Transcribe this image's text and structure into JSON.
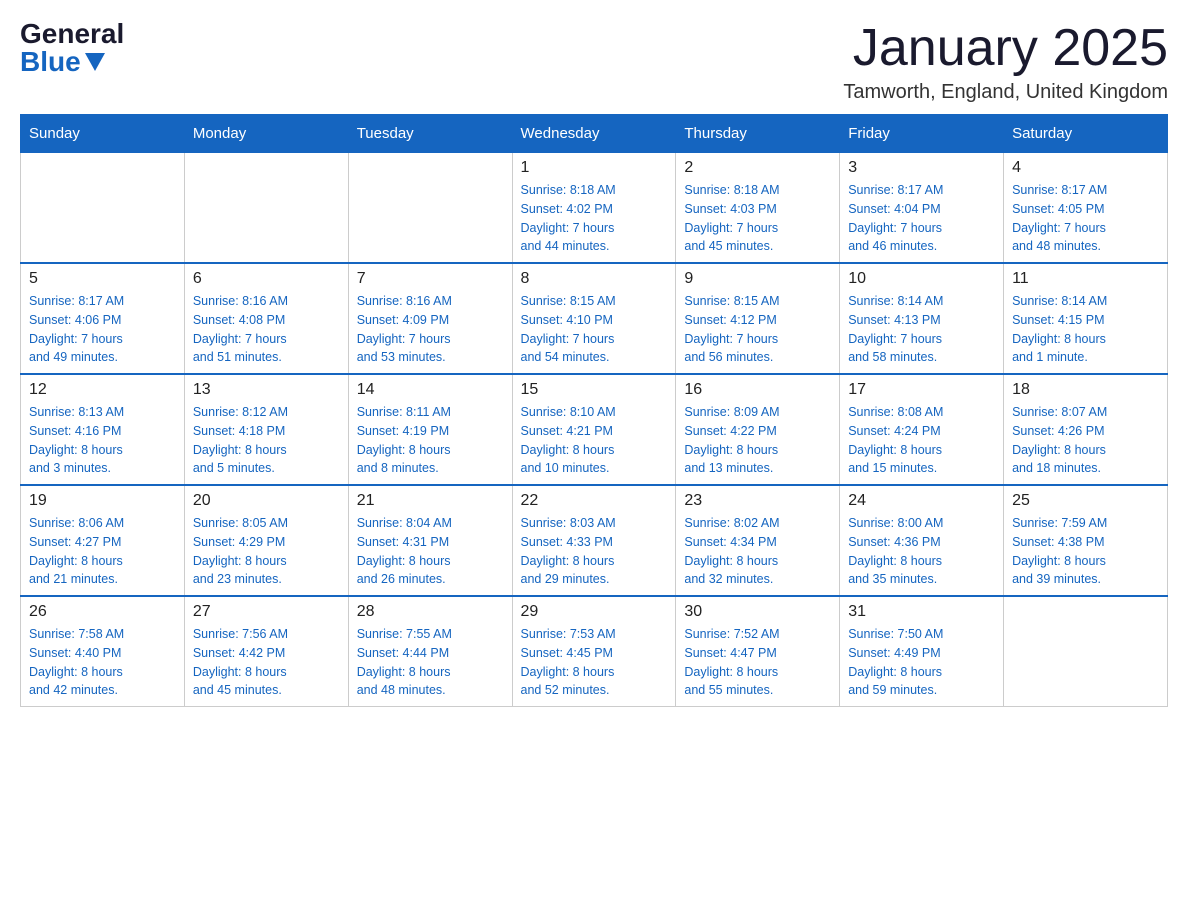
{
  "header": {
    "logo_general": "General",
    "logo_blue": "Blue",
    "title": "January 2025",
    "location": "Tamworth, England, United Kingdom"
  },
  "days_of_week": [
    "Sunday",
    "Monday",
    "Tuesday",
    "Wednesday",
    "Thursday",
    "Friday",
    "Saturday"
  ],
  "weeks": [
    {
      "days": [
        {
          "num": "",
          "info": ""
        },
        {
          "num": "",
          "info": ""
        },
        {
          "num": "",
          "info": ""
        },
        {
          "num": "1",
          "info": "Sunrise: 8:18 AM\nSunset: 4:02 PM\nDaylight: 7 hours\nand 44 minutes."
        },
        {
          "num": "2",
          "info": "Sunrise: 8:18 AM\nSunset: 4:03 PM\nDaylight: 7 hours\nand 45 minutes."
        },
        {
          "num": "3",
          "info": "Sunrise: 8:17 AM\nSunset: 4:04 PM\nDaylight: 7 hours\nand 46 minutes."
        },
        {
          "num": "4",
          "info": "Sunrise: 8:17 AM\nSunset: 4:05 PM\nDaylight: 7 hours\nand 48 minutes."
        }
      ]
    },
    {
      "days": [
        {
          "num": "5",
          "info": "Sunrise: 8:17 AM\nSunset: 4:06 PM\nDaylight: 7 hours\nand 49 minutes."
        },
        {
          "num": "6",
          "info": "Sunrise: 8:16 AM\nSunset: 4:08 PM\nDaylight: 7 hours\nand 51 minutes."
        },
        {
          "num": "7",
          "info": "Sunrise: 8:16 AM\nSunset: 4:09 PM\nDaylight: 7 hours\nand 53 minutes."
        },
        {
          "num": "8",
          "info": "Sunrise: 8:15 AM\nSunset: 4:10 PM\nDaylight: 7 hours\nand 54 minutes."
        },
        {
          "num": "9",
          "info": "Sunrise: 8:15 AM\nSunset: 4:12 PM\nDaylight: 7 hours\nand 56 minutes."
        },
        {
          "num": "10",
          "info": "Sunrise: 8:14 AM\nSunset: 4:13 PM\nDaylight: 7 hours\nand 58 minutes."
        },
        {
          "num": "11",
          "info": "Sunrise: 8:14 AM\nSunset: 4:15 PM\nDaylight: 8 hours\nand 1 minute."
        }
      ]
    },
    {
      "days": [
        {
          "num": "12",
          "info": "Sunrise: 8:13 AM\nSunset: 4:16 PM\nDaylight: 8 hours\nand 3 minutes."
        },
        {
          "num": "13",
          "info": "Sunrise: 8:12 AM\nSunset: 4:18 PM\nDaylight: 8 hours\nand 5 minutes."
        },
        {
          "num": "14",
          "info": "Sunrise: 8:11 AM\nSunset: 4:19 PM\nDaylight: 8 hours\nand 8 minutes."
        },
        {
          "num": "15",
          "info": "Sunrise: 8:10 AM\nSunset: 4:21 PM\nDaylight: 8 hours\nand 10 minutes."
        },
        {
          "num": "16",
          "info": "Sunrise: 8:09 AM\nSunset: 4:22 PM\nDaylight: 8 hours\nand 13 minutes."
        },
        {
          "num": "17",
          "info": "Sunrise: 8:08 AM\nSunset: 4:24 PM\nDaylight: 8 hours\nand 15 minutes."
        },
        {
          "num": "18",
          "info": "Sunrise: 8:07 AM\nSunset: 4:26 PM\nDaylight: 8 hours\nand 18 minutes."
        }
      ]
    },
    {
      "days": [
        {
          "num": "19",
          "info": "Sunrise: 8:06 AM\nSunset: 4:27 PM\nDaylight: 8 hours\nand 21 minutes."
        },
        {
          "num": "20",
          "info": "Sunrise: 8:05 AM\nSunset: 4:29 PM\nDaylight: 8 hours\nand 23 minutes."
        },
        {
          "num": "21",
          "info": "Sunrise: 8:04 AM\nSunset: 4:31 PM\nDaylight: 8 hours\nand 26 minutes."
        },
        {
          "num": "22",
          "info": "Sunrise: 8:03 AM\nSunset: 4:33 PM\nDaylight: 8 hours\nand 29 minutes."
        },
        {
          "num": "23",
          "info": "Sunrise: 8:02 AM\nSunset: 4:34 PM\nDaylight: 8 hours\nand 32 minutes."
        },
        {
          "num": "24",
          "info": "Sunrise: 8:00 AM\nSunset: 4:36 PM\nDaylight: 8 hours\nand 35 minutes."
        },
        {
          "num": "25",
          "info": "Sunrise: 7:59 AM\nSunset: 4:38 PM\nDaylight: 8 hours\nand 39 minutes."
        }
      ]
    },
    {
      "days": [
        {
          "num": "26",
          "info": "Sunrise: 7:58 AM\nSunset: 4:40 PM\nDaylight: 8 hours\nand 42 minutes."
        },
        {
          "num": "27",
          "info": "Sunrise: 7:56 AM\nSunset: 4:42 PM\nDaylight: 8 hours\nand 45 minutes."
        },
        {
          "num": "28",
          "info": "Sunrise: 7:55 AM\nSunset: 4:44 PM\nDaylight: 8 hours\nand 48 minutes."
        },
        {
          "num": "29",
          "info": "Sunrise: 7:53 AM\nSunset: 4:45 PM\nDaylight: 8 hours\nand 52 minutes."
        },
        {
          "num": "30",
          "info": "Sunrise: 7:52 AM\nSunset: 4:47 PM\nDaylight: 8 hours\nand 55 minutes."
        },
        {
          "num": "31",
          "info": "Sunrise: 7:50 AM\nSunset: 4:49 PM\nDaylight: 8 hours\nand 59 minutes."
        },
        {
          "num": "",
          "info": ""
        }
      ]
    }
  ]
}
